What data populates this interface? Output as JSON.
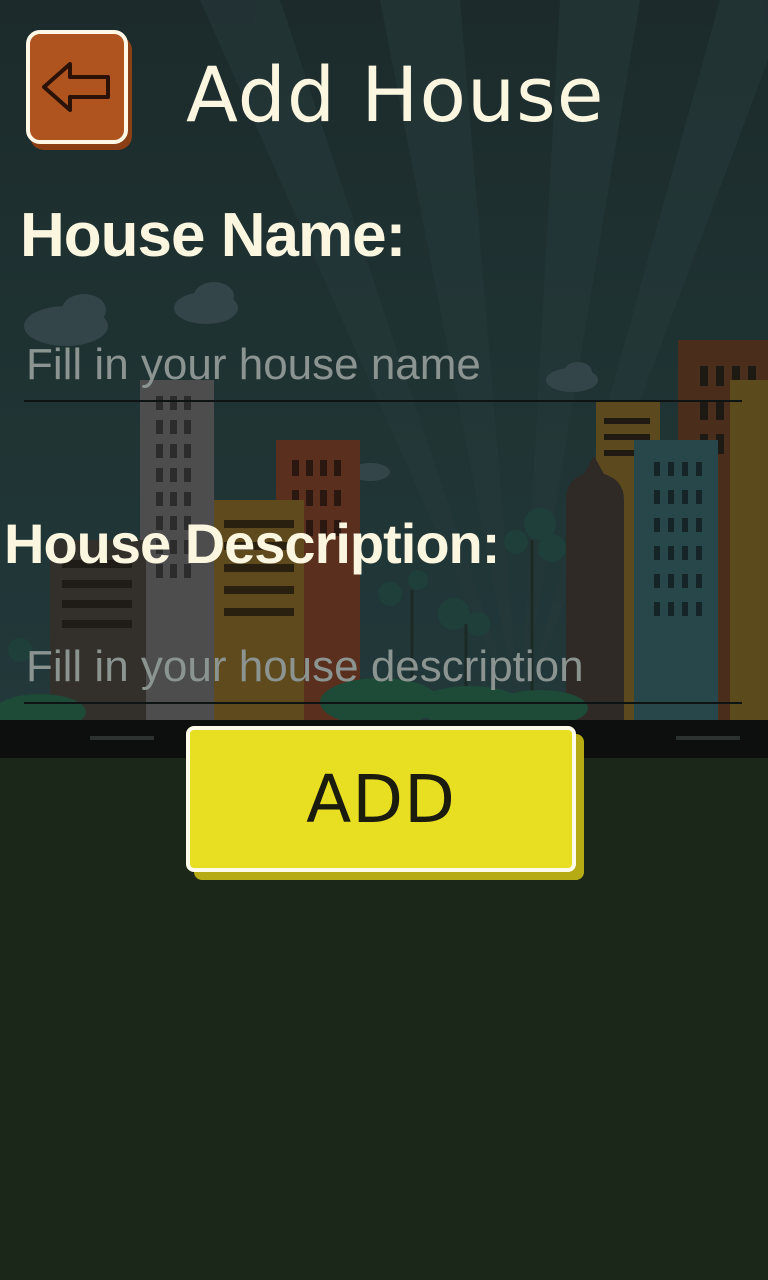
{
  "header": {
    "title": "Add House",
    "back_icon": "arrow-left-icon"
  },
  "form": {
    "name_label": "House Name:",
    "name_placeholder": "Fill in your house name",
    "name_value": "",
    "description_label": "House Description:",
    "description_placeholder": "Fill in your house description",
    "description_value": "",
    "submit_label": "ADD"
  },
  "colors": {
    "back_button": "#b0541f",
    "add_button": "#e9df22",
    "text": "#fbf6e0",
    "ground": "#1b2718"
  }
}
